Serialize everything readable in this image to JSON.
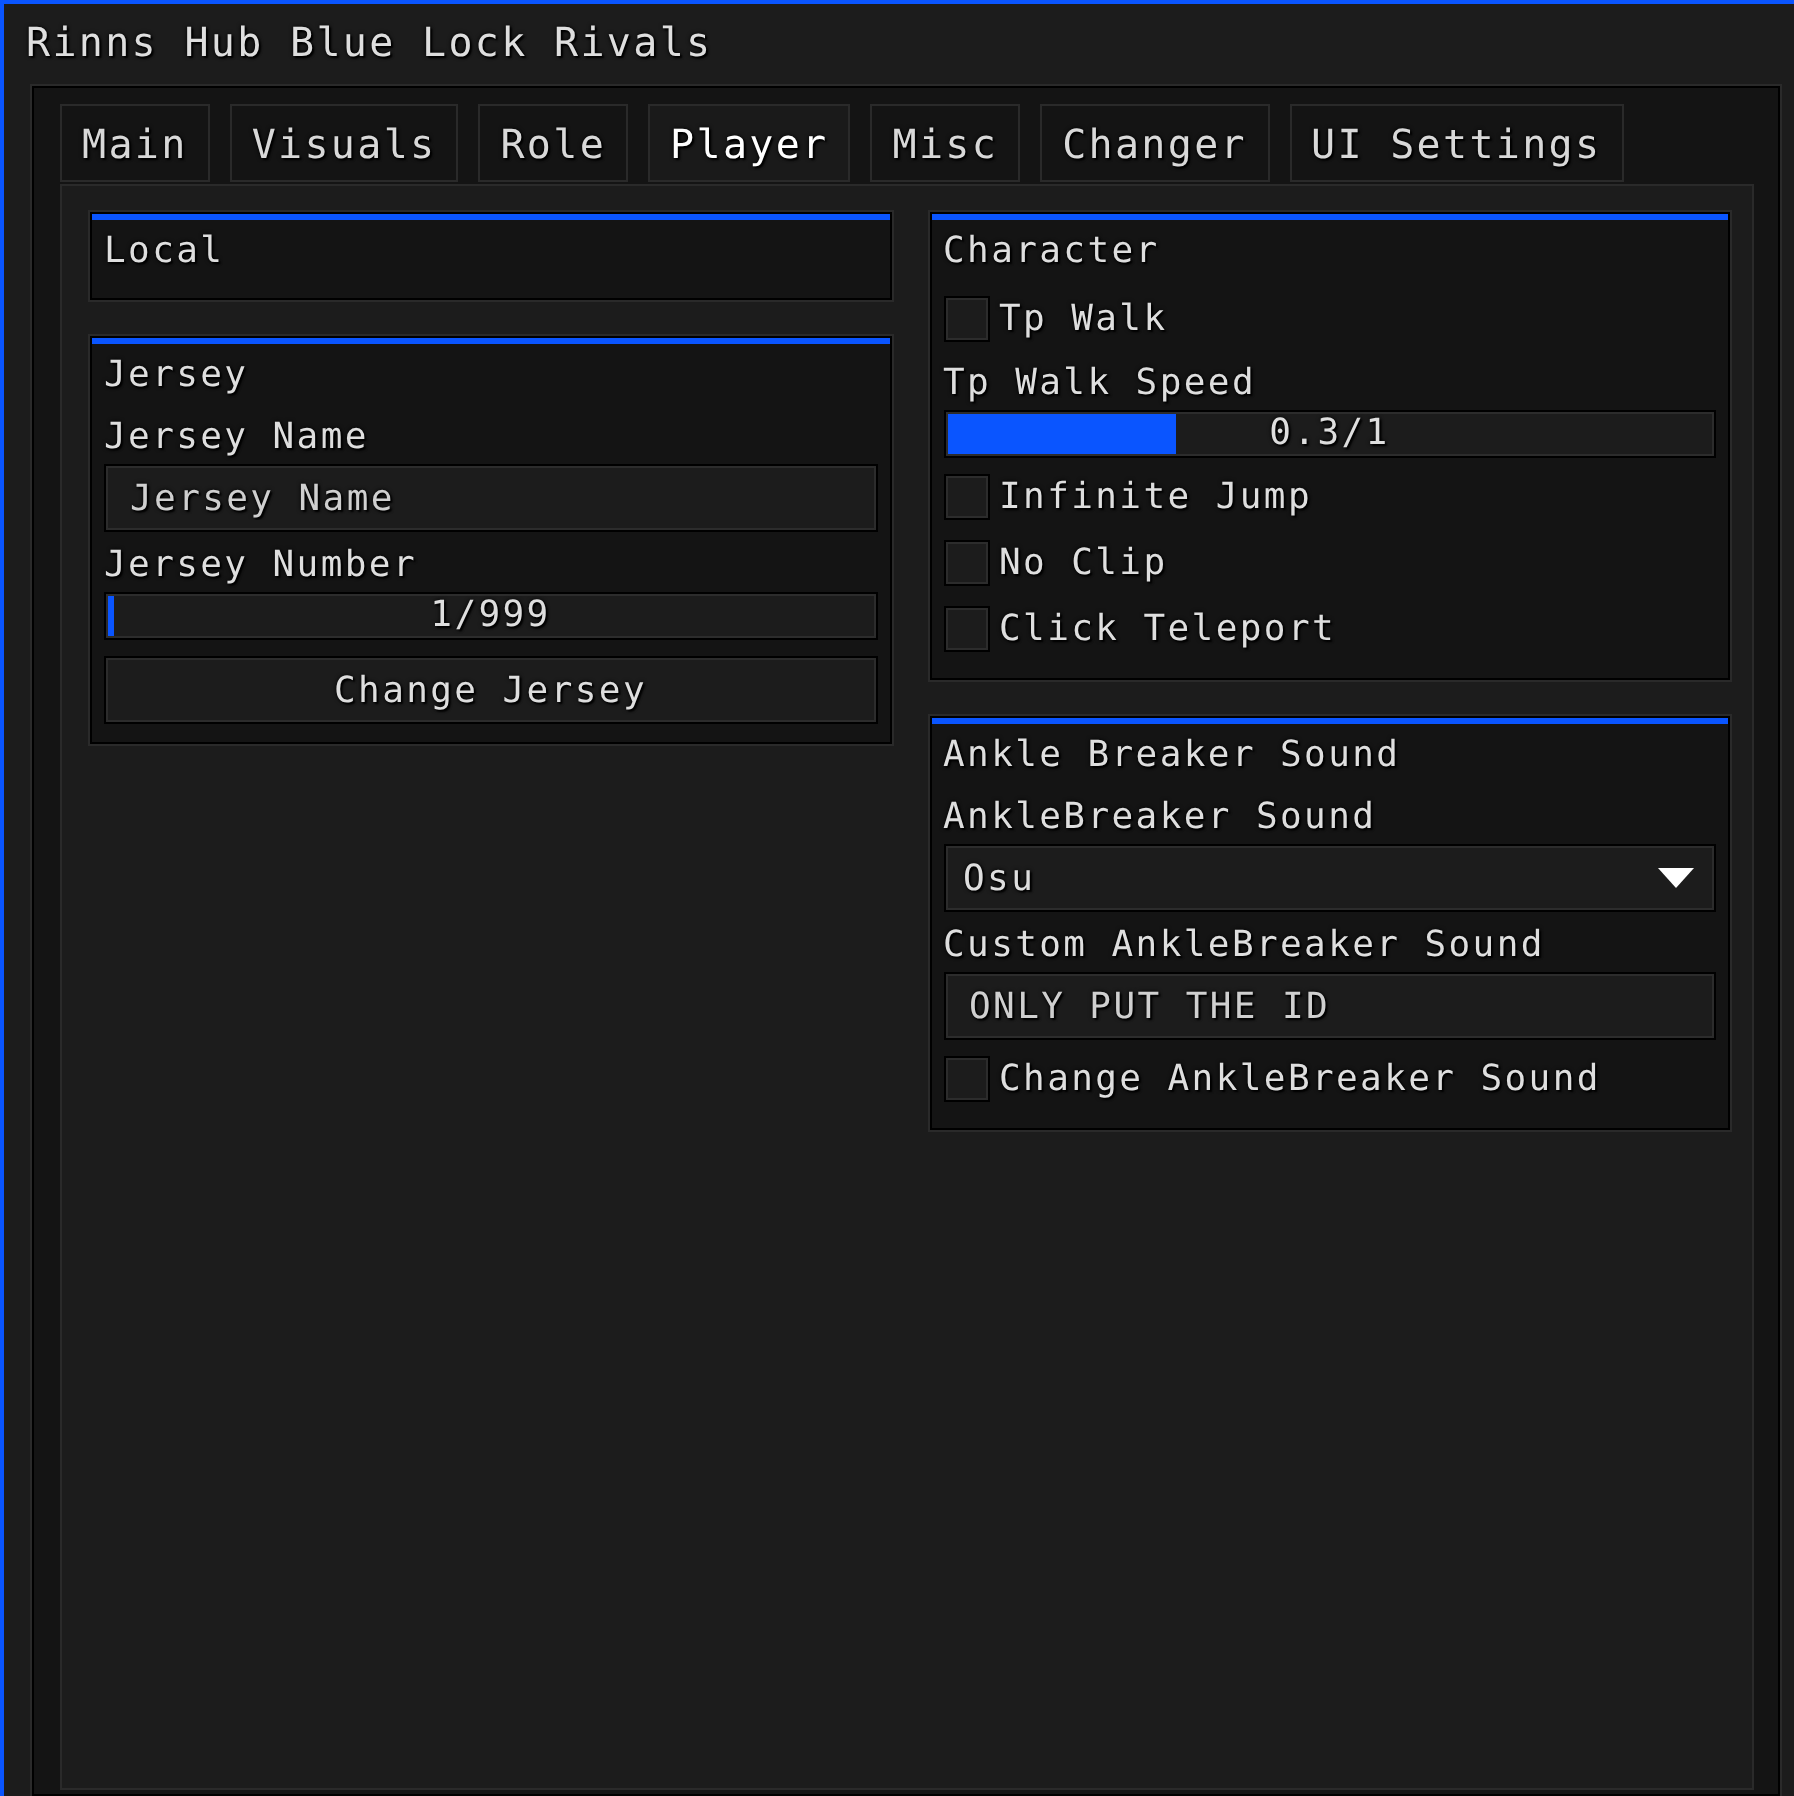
{
  "window": {
    "title": "Rinns Hub Blue Lock Rivals"
  },
  "tabs": [
    {
      "label": "Main",
      "selected": false
    },
    {
      "label": "Visuals",
      "selected": false
    },
    {
      "label": "Role",
      "selected": false
    },
    {
      "label": "Player",
      "selected": true
    },
    {
      "label": "Misc",
      "selected": false
    },
    {
      "label": "Changer",
      "selected": false
    },
    {
      "label": "UI Settings",
      "selected": false
    }
  ],
  "columns": [
    {
      "groups": [
        {
          "title": "Local"
        },
        {
          "title": "Jersey",
          "items": [
            {
              "kind": "label",
              "text": "Jersey Name"
            },
            {
              "kind": "input",
              "placeholder": "Jersey Name"
            },
            {
              "kind": "label",
              "text": "Jersey Number"
            },
            {
              "kind": "slider",
              "reading": "1/999",
              "level": 0.008
            },
            {
              "kind": "button",
              "label": "Change Jersey"
            }
          ]
        }
      ]
    },
    {
      "groups": [
        {
          "title": "Character",
          "items": [
            {
              "kind": "checkbox",
              "label": "Tp Walk",
              "checked": false
            },
            {
              "kind": "label",
              "text": "Tp Walk Speed"
            },
            {
              "kind": "slider",
              "reading": "0.3/1",
              "level": 0.3
            },
            {
              "kind": "checkbox",
              "label": "Infinite Jump",
              "checked": false
            },
            {
              "kind": "checkbox",
              "label": "No Clip",
              "checked": false
            },
            {
              "kind": "checkbox",
              "label": "Click Teleport",
              "checked": false
            }
          ]
        },
        {
          "title": "Ankle Breaker Sound",
          "items": [
            {
              "kind": "label",
              "text": "AnkleBreaker Sound"
            },
            {
              "kind": "dropdown",
              "value": "Osu"
            },
            {
              "kind": "label",
              "text": "Custom AnkleBreaker Sound"
            },
            {
              "kind": "input",
              "placeholder": "ONLY PUT THE ID"
            },
            {
              "kind": "checkbox",
              "label": "Change AnkleBreaker Sound",
              "checked": false
            }
          ]
        }
      ]
    }
  ]
}
